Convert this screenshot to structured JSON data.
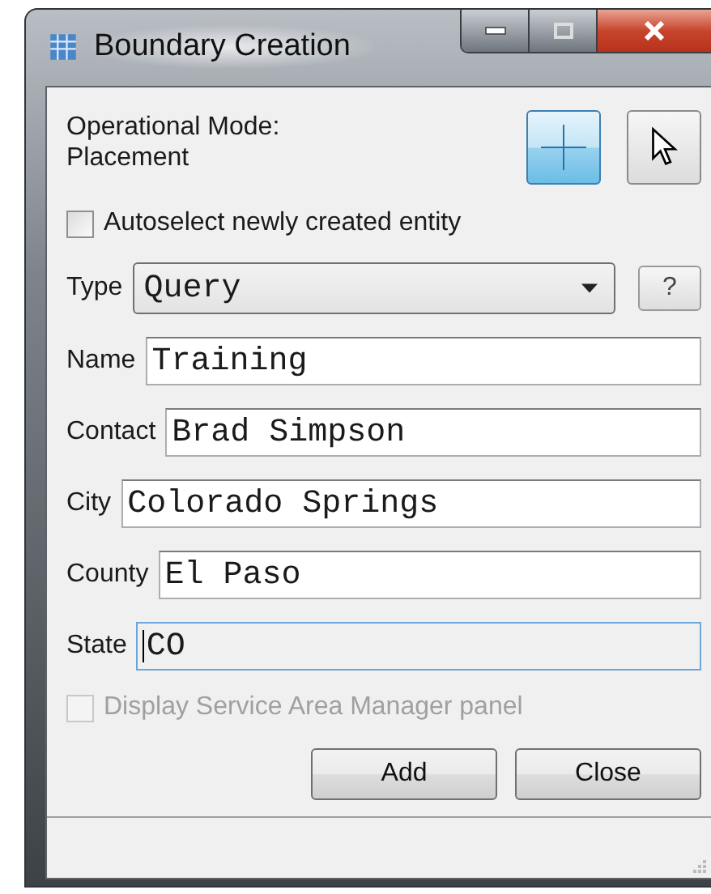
{
  "window": {
    "title": "Boundary Creation",
    "controls": [
      {
        "kind": "minimize"
      },
      {
        "kind": "maximize"
      },
      {
        "kind": "close"
      }
    ]
  },
  "mode": {
    "label": "Operational Mode:",
    "value": "Placement",
    "tools": [
      {
        "kind": "crosshair",
        "selected": true
      },
      {
        "kind": "pointer",
        "selected": false
      }
    ]
  },
  "autoselect": {
    "label": "Autoselect newly created entity",
    "checked": false,
    "disabled": false
  },
  "fields": [
    {
      "label": "Type",
      "kind": "dropdown",
      "value": "Query",
      "focused": false,
      "help": "?"
    },
    {
      "label": "Name",
      "kind": "text",
      "value": "Training",
      "focused": false
    },
    {
      "label": "Contact",
      "kind": "text",
      "value": "Brad Simpson",
      "focused": false
    },
    {
      "label": "City",
      "kind": "text",
      "value": "Colorado Springs",
      "focused": false
    },
    {
      "label": "County",
      "kind": "text",
      "value": "El Paso",
      "focused": false
    },
    {
      "label": "State",
      "kind": "text",
      "value": "CO",
      "focused": true
    }
  ],
  "display_panel": {
    "label": "Display Service Area Manager panel",
    "checked": false,
    "disabled": true
  },
  "buttons": [
    "Add",
    "Close"
  ]
}
